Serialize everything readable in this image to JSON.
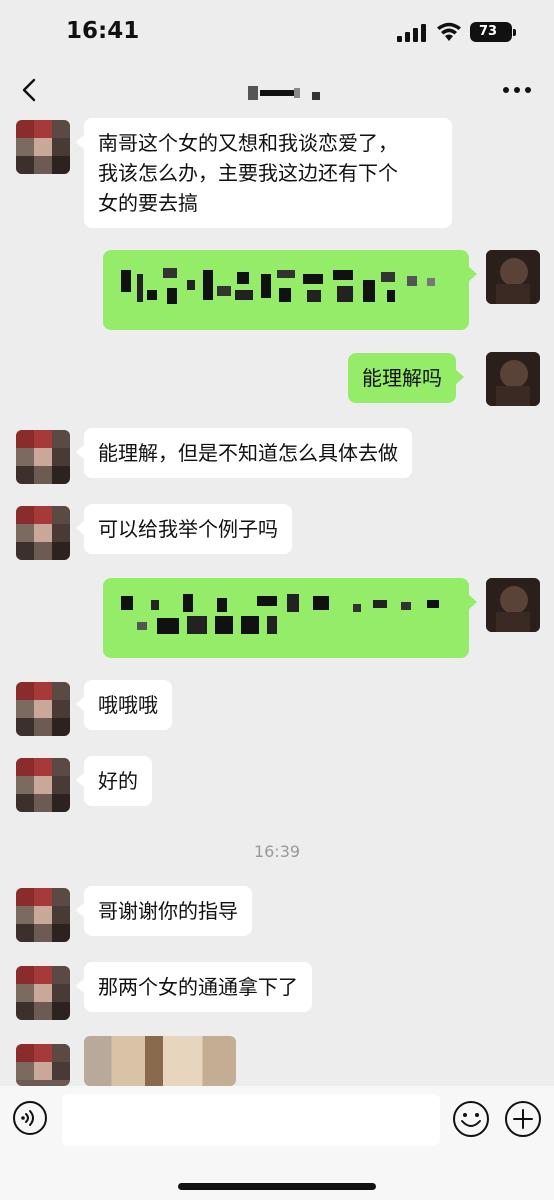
{
  "status_bar": {
    "time": "16:41",
    "battery": "73"
  },
  "nav": {
    "title_hidden": true
  },
  "messages": [
    {
      "side": "left",
      "text": "南哥这个女的又想和我谈恋爱了，\n我该怎么办，主要我这边还有下个\n女的要去搞"
    },
    {
      "side": "right",
      "blurred": true
    },
    {
      "side": "right",
      "text": "能理解吗"
    },
    {
      "side": "left",
      "text": "能理解，但是不知道怎么具体去做"
    },
    {
      "side": "left",
      "text": "可以给我举个例子吗"
    },
    {
      "side": "right",
      "blurred": true
    },
    {
      "side": "left",
      "text": "哦哦哦"
    },
    {
      "side": "left",
      "text": "好的"
    },
    {
      "side": "left",
      "text": "哥谢谢你的指导"
    },
    {
      "side": "left",
      "text": "那两个女的通通拿下了"
    },
    {
      "side": "left",
      "type": "image"
    }
  ],
  "timestamp": "16:39",
  "input": {
    "placeholder": ""
  },
  "icons": {
    "back": "chevron-left-icon",
    "more": "more-dots-icon",
    "voice": "voice-icon",
    "emoji": "emoji-icon",
    "plus": "plus-icon"
  },
  "colors": {
    "bubble_self": "#95ec69",
    "bubble_other": "#ffffff",
    "background": "#ededed"
  }
}
